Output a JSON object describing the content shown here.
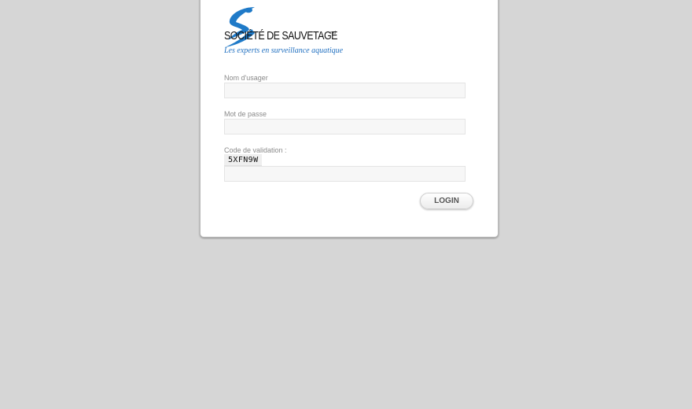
{
  "brand": {
    "name": "SOCIÉTÉ DE SAUVETAGE",
    "mark": "md",
    "tagline": "Les experts en surveillance aquatique",
    "logo_color": "#1f7ac8"
  },
  "form": {
    "username": {
      "label": "Nom d'usager",
      "value": ""
    },
    "password": {
      "label": "Mot de passe",
      "value": ""
    },
    "validation": {
      "label": "Code de validation :",
      "captcha_code": "5XFN9W",
      "value": ""
    },
    "login_label": "LOGIN"
  },
  "colors": {
    "page_background": "#d6d6d6",
    "card_background": "#ffffff",
    "tagline": "#1f6fc0",
    "label": "#8a8a8a"
  }
}
